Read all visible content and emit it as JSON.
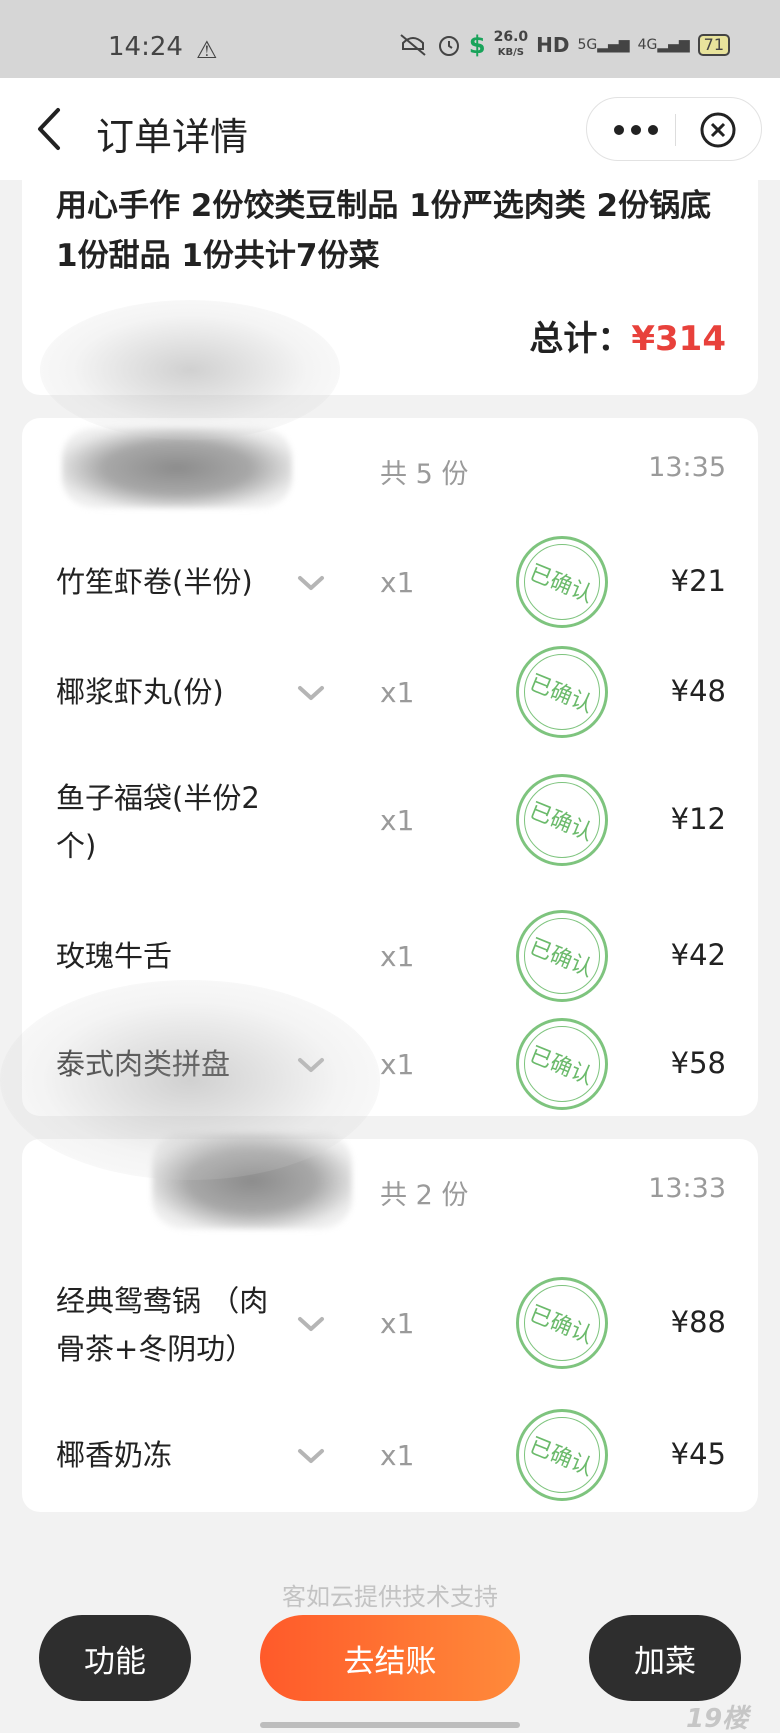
{
  "status_bar": {
    "time": "14:24",
    "network_speed": "26.0",
    "network_unit": "KB/S",
    "hd_label": "HD",
    "signal_5g": "5G",
    "signal_4g": "4G",
    "battery": "71"
  },
  "header": {
    "title": "订单详情"
  },
  "summary": {
    "text": "用心手作 2份饺类豆制品 1份严选肉类 2份锅底 1份甜品 1份共计7份菜",
    "total_label": "总计：",
    "total_value": "¥314"
  },
  "orders": [
    {
      "count": "共 5 份",
      "time": "13:35",
      "items": [
        {
          "name": "竹笙虾卷(半份)",
          "qty": "x1",
          "status": "已确认",
          "price": "¥21",
          "expandable": true
        },
        {
          "name": "椰浆虾丸(份)",
          "qty": "x1",
          "status": "已确认",
          "price": "¥48",
          "expandable": true
        },
        {
          "name": "鱼子福袋(半份2个)",
          "qty": "x1",
          "status": "已确认",
          "price": "¥12",
          "expandable": false
        },
        {
          "name": "玫瑰牛舌",
          "qty": "x1",
          "status": "已确认",
          "price": "¥42",
          "expandable": false
        },
        {
          "name": "泰式肉类拼盘",
          "qty": "x1",
          "status": "已确认",
          "price": "¥58",
          "expandable": true
        }
      ]
    },
    {
      "count": "共 2 份",
      "time": "13:33",
      "items": [
        {
          "name": "经典鸳鸯锅 （肉骨茶+冬阴功）",
          "qty": "x1",
          "status": "已确认",
          "price": "¥88",
          "expandable": true
        },
        {
          "name": "椰香奶冻",
          "qty": "x1",
          "status": "已确认",
          "price": "¥45",
          "expandable": true
        }
      ]
    }
  ],
  "footer": {
    "powered_by": "客如云提供技术支持",
    "func_label": "功能",
    "checkout_label": "去结账",
    "add_label": "加菜",
    "watermark": "19楼"
  },
  "colors": {
    "accent_red": "#e8413b",
    "stamp_green": "#7ec47e",
    "checkout_orange": "#ff6a30",
    "dark_button": "#2e2e2e"
  }
}
